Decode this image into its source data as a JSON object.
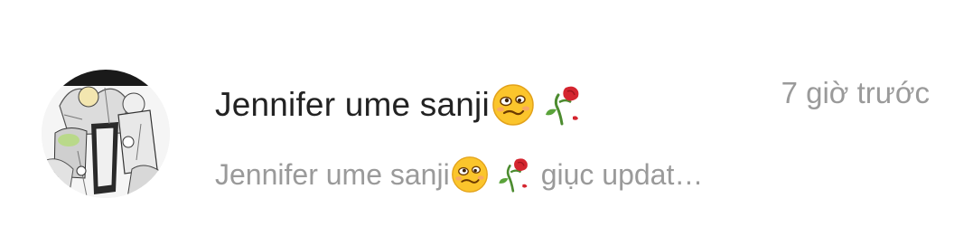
{
  "notification": {
    "sender_name": "Jennifer ume sanji",
    "timestamp": "7 giờ trước",
    "preview": {
      "sender": "Jennifer ume sanji",
      "message": "giục updat…"
    },
    "emojis": [
      "woozy-face-icon",
      "wilted-flower-icon"
    ]
  }
}
